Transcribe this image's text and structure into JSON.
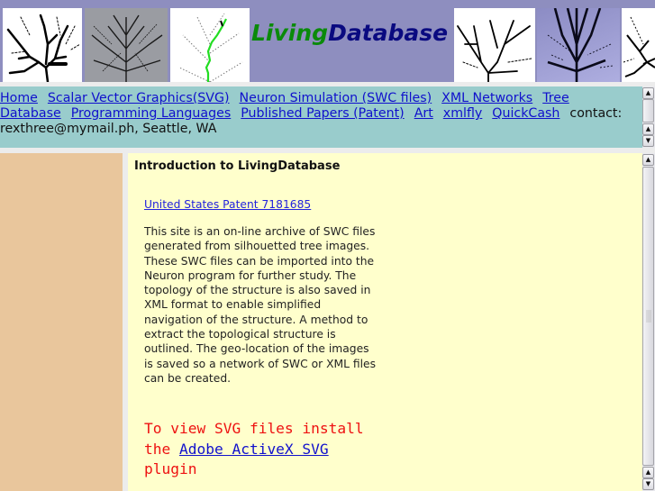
{
  "header": {
    "logo_part1": "Living",
    "logo_part2": "Database",
    "thumbnails": [
      {
        "name": "tree-silhouette-1",
        "style": "black-on-white"
      },
      {
        "name": "tree-photo-gray",
        "style": "photo-gray"
      },
      {
        "name": "tree-trace-green",
        "style": "traced-green"
      },
      {
        "name": "tree-silhouette-2",
        "style": "black-on-white"
      },
      {
        "name": "tree-photo-purple",
        "style": "photo-purple"
      },
      {
        "name": "tree-silhouette-3",
        "style": "black-on-white"
      }
    ],
    "colors": {
      "background": "#8e8ebf",
      "living": "#0a8a0a",
      "database": "#0a0a80"
    }
  },
  "nav": {
    "links": [
      "Home",
      "Scalar Vector Graphics(SVG)",
      "Neuron Simulation (SWC files)",
      "XML Networks",
      "Tree Database",
      "Programming Languages",
      "Published Papers (Patent)",
      "Art",
      "xmlfly",
      "QuickCash"
    ],
    "contact_label": "contact:",
    "contact_value": "rexthree@mymail.ph, Seattle, WA",
    "background": "#99cccc"
  },
  "sidebar": {
    "background": "#e9c69c"
  },
  "content": {
    "title": "Introduction to LivingDatabase",
    "patent_link": "United States Patent 7181685",
    "description": "This site is an on-line archive of SWC files generated from silhouetted tree images. These SWC files can be imported into the Neuron program for further study. The topology of the structure is also saved in XML format to enable simplified navigation of the structure. A method to extract the topological structure is outlined. The geo-location of the images is saved so a network of SWC or XML files can be created.",
    "svg_note_before": "To view SVG files install the ",
    "svg_link": "Adobe ActiveX SVG ",
    "svg_note_after": "plugin",
    "background": "#ffffcc",
    "note_color": "#ee1111"
  }
}
